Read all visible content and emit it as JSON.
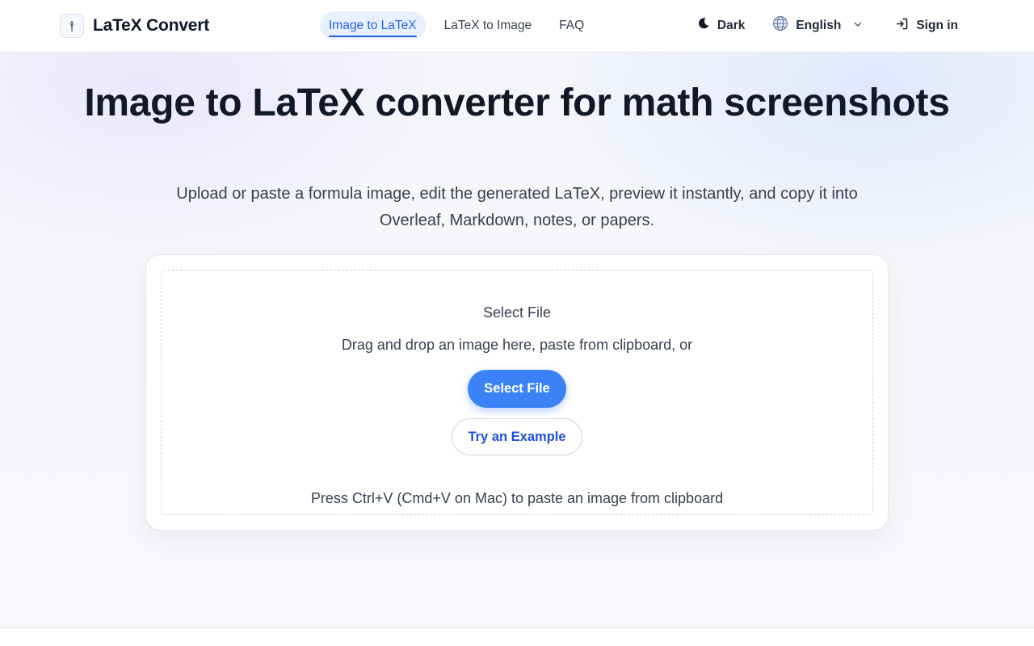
{
  "header": {
    "logo_text": "LaTeX Convert",
    "nav": [
      {
        "label": "Image to LaTeX",
        "active": true
      },
      {
        "label": "LaTeX to Image",
        "active": false
      },
      {
        "label": "FAQ",
        "active": false
      }
    ],
    "theme_label": "Dark",
    "language_label": "English",
    "signin_label": "Sign in"
  },
  "hero": {
    "title": "Image to LaTeX converter for math screenshots",
    "subtitle": "Upload or paste a formula image, edit the generated LaTeX, preview it instantly, and copy it into Overleaf, Markdown, notes, or papers."
  },
  "upload": {
    "title": "Select File",
    "description": "Drag and drop an image here, paste from clipboard, or",
    "select_button": "Select File",
    "example_button": "Try an Example",
    "hint": "Press Ctrl+V (Cmd+V on Mac) to paste an image from clipboard"
  },
  "colors": {
    "accent": "#3b82f6",
    "accent_text": "#2563eb",
    "active_tab_bg": "#e8effd"
  },
  "icons": {
    "logo": "pen-nib-icon",
    "theme": "moon-icon",
    "language": "globe-icon",
    "language_dropdown": "chevron-down-icon",
    "signin": "sign-in-icon"
  }
}
